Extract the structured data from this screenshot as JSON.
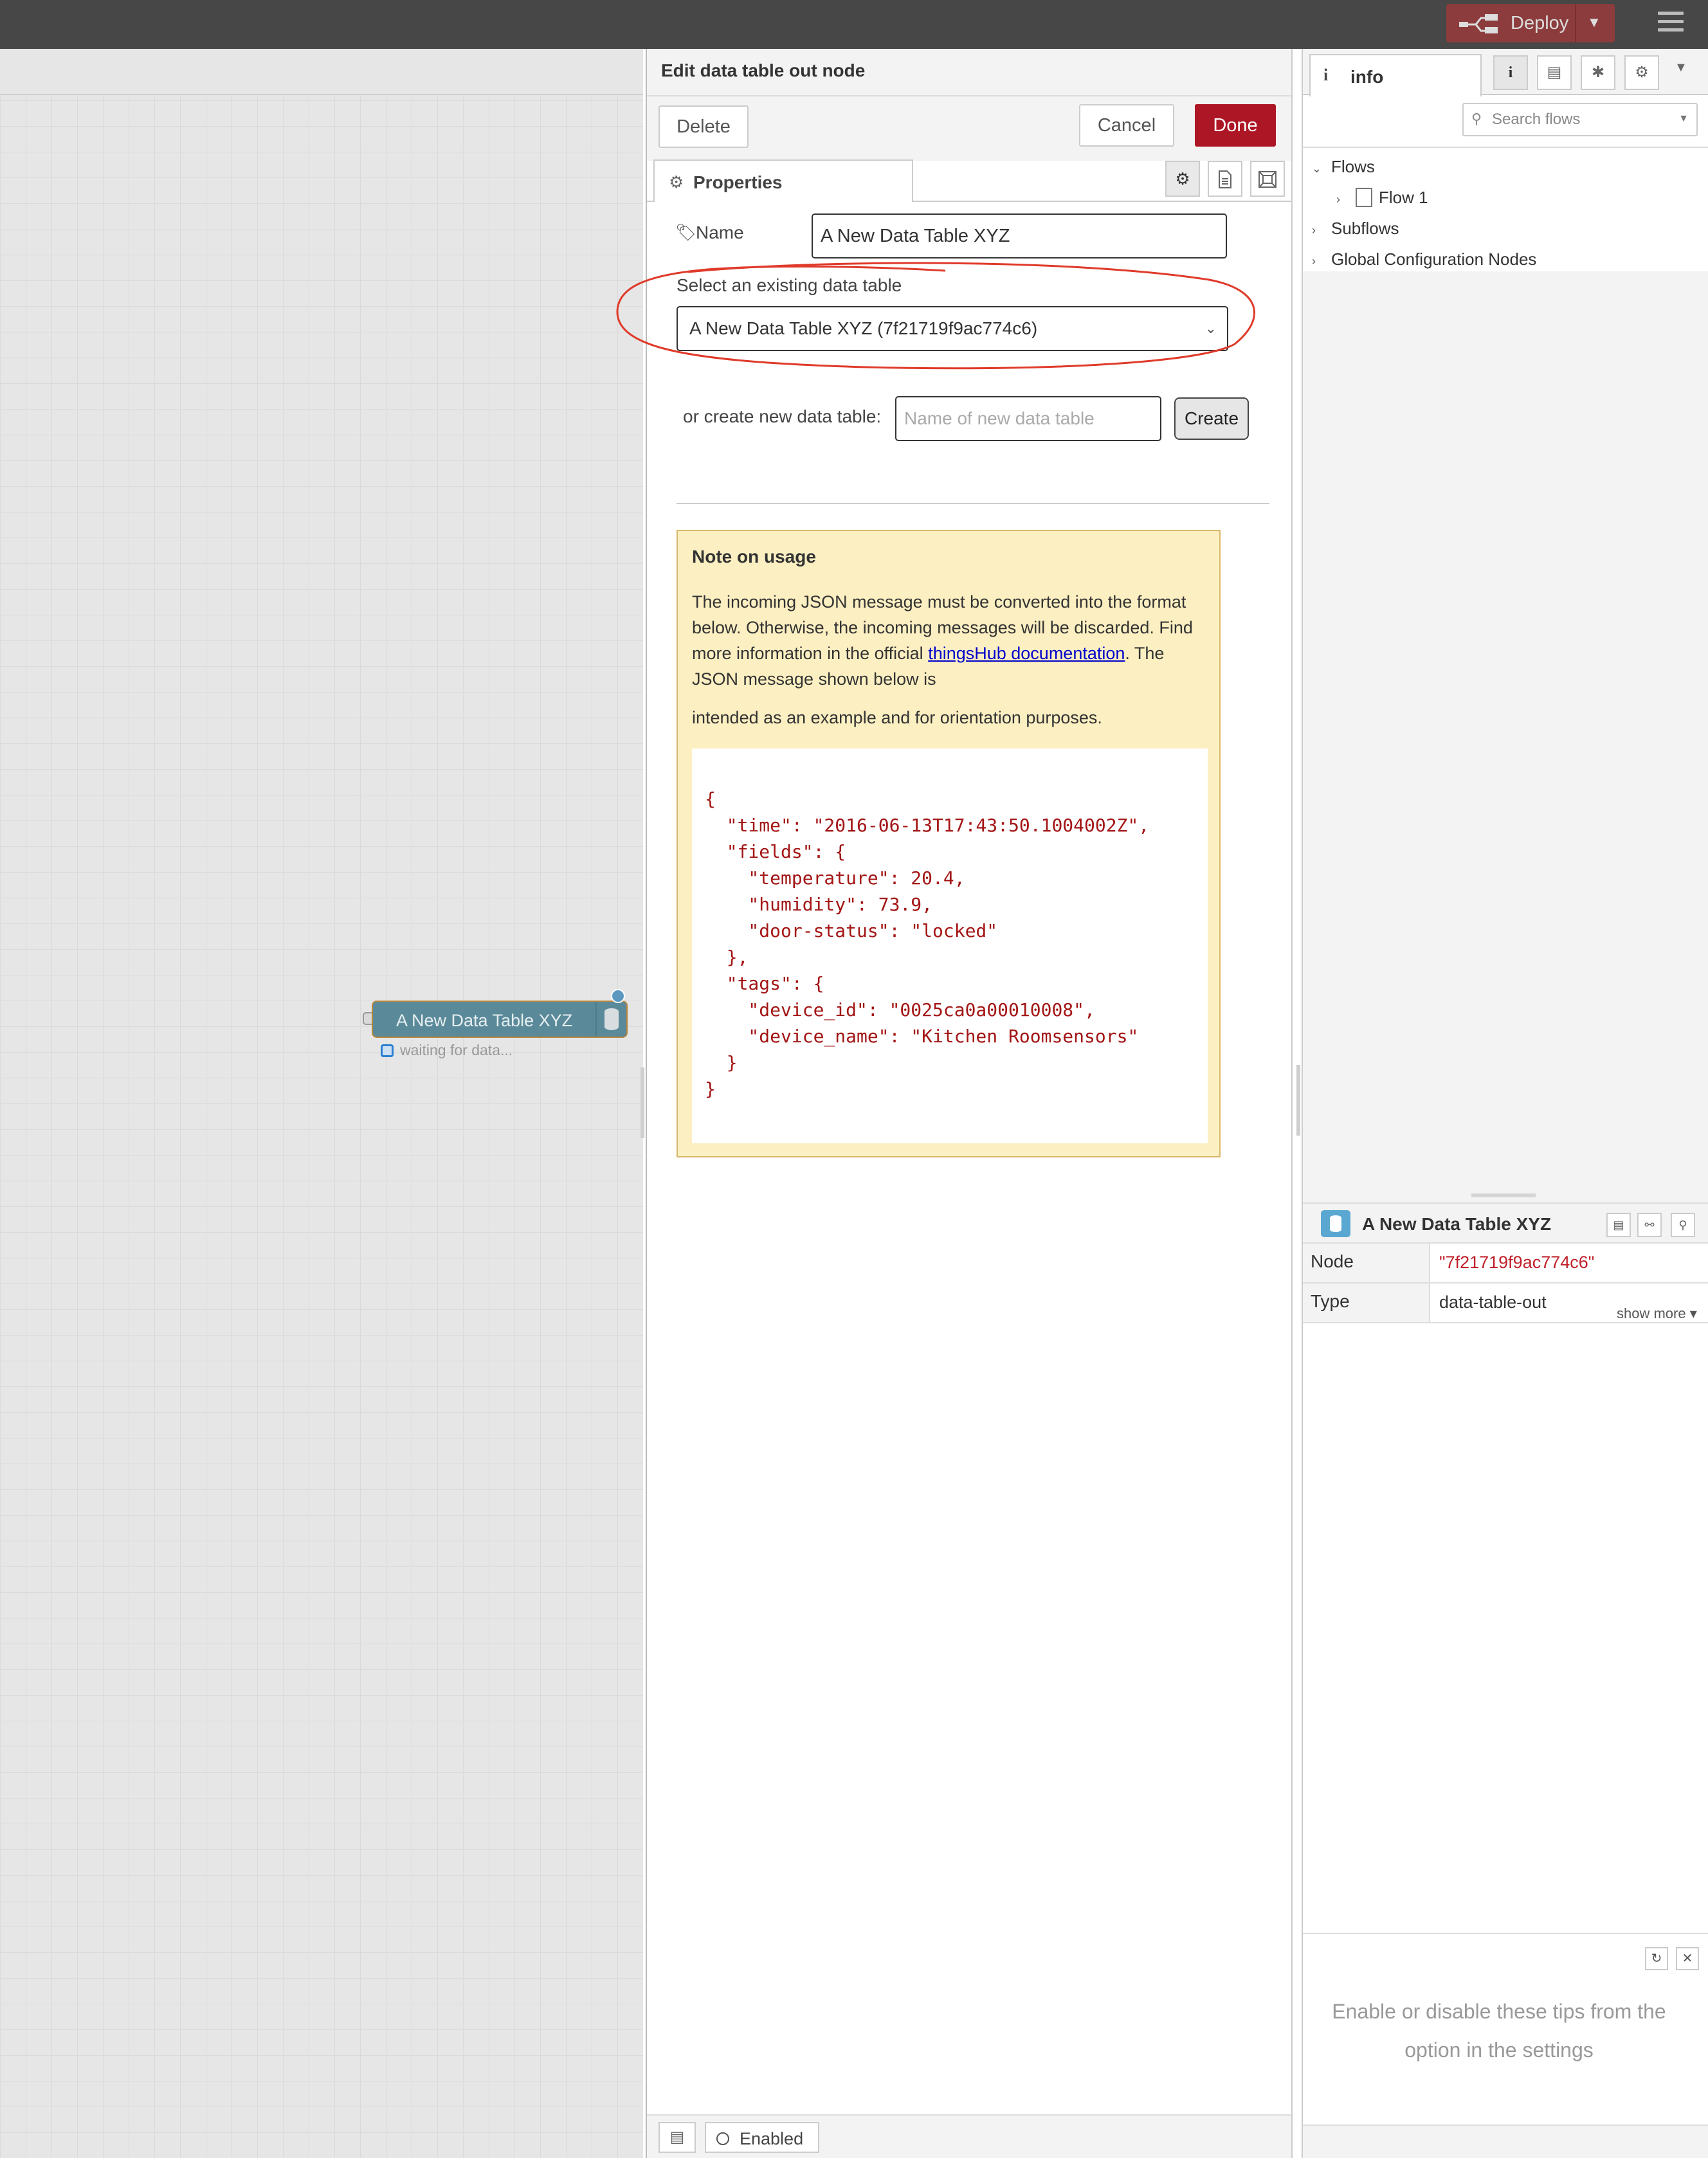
{
  "header": {
    "deploy_label": "Deploy",
    "deploy_color": "#8c3c3c"
  },
  "workspace": {
    "node": {
      "label": "A New Data Table XYZ",
      "status": "waiting for data..."
    }
  },
  "tray": {
    "title": "Edit data table out node",
    "delete_label": "Delete",
    "cancel_label": "Cancel",
    "done_label": "Done",
    "done_color": "#ad1625",
    "properties_tab": "Properties",
    "name_label": "Name",
    "name_value": "A New Data Table XYZ",
    "select_label": "Select an existing data table",
    "select_value": "A New Data Table XYZ (7f21719f9ac774c6)",
    "create_label": "or create new data table:",
    "new_table_placeholder": "Name of new data table",
    "create_button": "Create",
    "note": {
      "title": "Note on usage",
      "text_before_link": "The incoming JSON message must be converted into the format below. Otherwise, the incoming messages will be discarded. Find more information in the official ",
      "link_text": "thingsHub documentation",
      "text_after_link": ". The JSON message shown below is",
      "text_line2": "intended as an example and for orientation purposes.",
      "json_example": "{\n  \"time\": \"2016-06-13T17:43:50.1004002Z\",\n  \"fields\": {\n    \"temperature\": 20.4,\n    \"humidity\": 73.9,\n    \"door-status\": \"locked\"\n  },\n  \"tags\": {\n    \"device_id\": \"0025ca0a00010008\",\n    \"device_name\": \"Kitchen Roomsensors\"\n  }\n}"
    },
    "footer_enabled_label": "Enabled"
  },
  "sidebar": {
    "tab_label": "info",
    "search_placeholder": "Search flows",
    "tree": {
      "flows": "Flows",
      "flow1": "Flow 1",
      "subflows": "Subflows",
      "global": "Global Configuration Nodes"
    },
    "node_info": {
      "title": "A New Data Table XYZ",
      "node_key": "Node",
      "node_value": "\"7f21719f9ac774c6\"",
      "type_key": "Type",
      "type_value": "data-table-out",
      "show_more": "show more"
    },
    "tip_text": "Enable or disable these tips from the option in the settings"
  },
  "icons": {
    "deploy": "deploy-icon",
    "menu": "hamburger-menu-icon",
    "properties": "gear-icon",
    "name": "tag-icon",
    "info": "info-icon",
    "help": "book-icon",
    "debug": "bug-icon",
    "config": "gear-icon",
    "search": "search-icon",
    "flow": "flow-icon",
    "refresh": "refresh-icon",
    "close": "close-icon"
  }
}
